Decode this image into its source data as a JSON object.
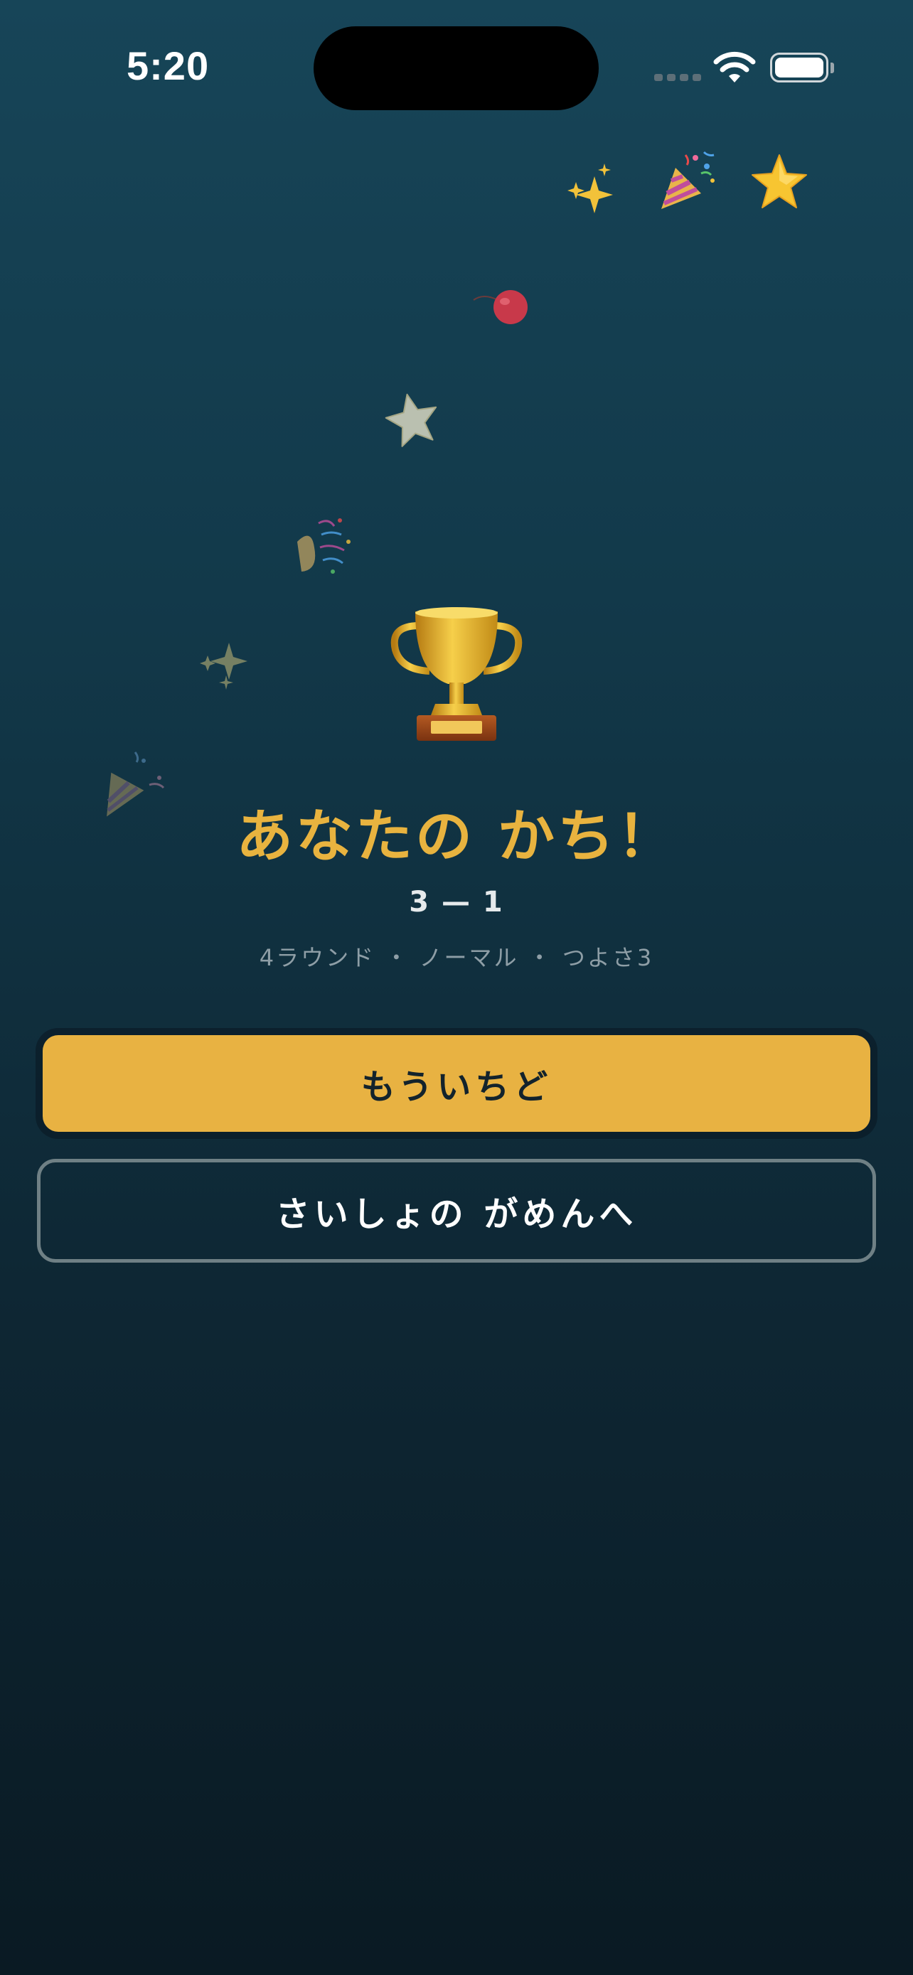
{
  "status_bar": {
    "time": "5:20"
  },
  "result": {
    "title": "あなたの かち！",
    "score": "3 — 1",
    "details": "4ラウンド ・ ノーマル ・ つよさ3"
  },
  "buttons": {
    "retry_label": "もういちど",
    "home_label": "さいしょの がめんへ"
  },
  "colors": {
    "accent": "#e8b242",
    "title": "#e8b33f",
    "background_top": "#174558",
    "background_bottom": "#0a1a23"
  },
  "icons": [
    "sparkles-icon",
    "party-popper-icon",
    "star-icon",
    "balloon-icon",
    "confetti-icon",
    "trophy-icon"
  ]
}
